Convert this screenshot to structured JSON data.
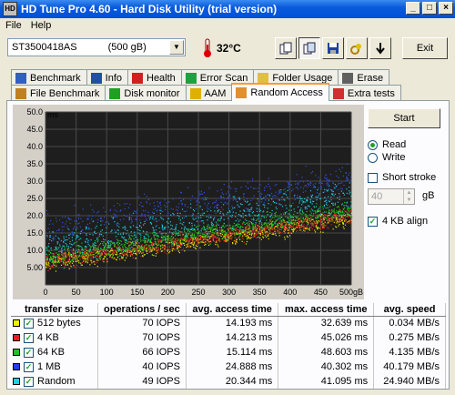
{
  "window": {
    "title": "HD Tune Pro 4.60 - Hard Disk Utility (trial version)",
    "icon_text": "HD"
  },
  "window_buttons": {
    "minimize": "_",
    "maximize": "□",
    "close": "×"
  },
  "menu": {
    "file": "File",
    "help": "Help"
  },
  "toolbar": {
    "drive": "ST3500418AS",
    "drive_size": "(500 gB)",
    "temperature": "32°C",
    "exit_label": "Exit",
    "buttons": [
      "copy-info-icon",
      "copy-screenshot-icon",
      "save-icon",
      "options-icon",
      "download-icon"
    ]
  },
  "tabs_top": [
    {
      "label": "Benchmark",
      "icon": "benchmark-icon",
      "color": "#3060c0"
    },
    {
      "label": "Info",
      "icon": "info-icon",
      "color": "#2050a0"
    },
    {
      "label": "Health",
      "icon": "health-icon",
      "color": "#d02020"
    },
    {
      "label": "Error Scan",
      "icon": "error-scan-icon",
      "color": "#20a040"
    },
    {
      "label": "Folder Usage",
      "icon": "folder-icon",
      "color": "#e0c040"
    },
    {
      "label": "Erase",
      "icon": "erase-icon",
      "color": "#606060"
    }
  ],
  "tabs_bottom": [
    {
      "label": "File Benchmark",
      "icon": "file-benchmark-icon",
      "color": "#c08020"
    },
    {
      "label": "Disk monitor",
      "icon": "disk-monitor-icon",
      "color": "#20a020"
    },
    {
      "label": "AAM",
      "icon": "speaker-icon",
      "color": "#e0b000"
    },
    {
      "label": "Random Access",
      "icon": "random-access-icon",
      "color": "#e09030",
      "active": true
    },
    {
      "label": "Extra tests",
      "icon": "extra-tests-icon",
      "color": "#d03030"
    }
  ],
  "controls": {
    "start_label": "Start",
    "read_label": "Read",
    "write_label": "Write",
    "mode": "read",
    "short_stroke_label": "Short stroke",
    "short_stroke_checked": false,
    "stroke_value": "40",
    "stroke_unit": "gB",
    "align_label": "4 KB align",
    "align_checked": true
  },
  "chart_data": {
    "type": "scatter",
    "ylabel": "ms",
    "xlabel": "gB",
    "xlim": [
      0,
      500
    ],
    "ylim": [
      0,
      50
    ],
    "y_ticks": [
      "50.0",
      "45.0",
      "40.0",
      "35.0",
      "30.0",
      "25.0",
      "20.0",
      "15.0",
      "10.0",
      "5.00"
    ],
    "x_ticks": [
      "0",
      "50",
      "100",
      "150",
      "200",
      "250",
      "300",
      "350",
      "400",
      "450",
      "500gB"
    ],
    "series": [
      {
        "name": "512 bytes",
        "color": "#e8e800",
        "min": 4.0,
        "max": 32.6
      },
      {
        "name": "4 KB",
        "color": "#e02020",
        "min": 4.0,
        "max": 45.0
      },
      {
        "name": "64 KB",
        "color": "#20c020",
        "min": 4.5,
        "max": 48.6
      },
      {
        "name": "1 MB",
        "color": "#3050e0",
        "min": 9.0,
        "max": 40.3
      },
      {
        "name": "Random",
        "color": "#20c8e0",
        "min": 5.0,
        "max": 41.1
      }
    ]
  },
  "results": {
    "headers": [
      "transfer size",
      "operations / sec",
      "avg. access time",
      "max. access time",
      "avg. speed"
    ],
    "rows": [
      {
        "name": "512 bytes",
        "color": "#f0f000",
        "ops": "70 IOPS",
        "avg": "14.193 ms",
        "max": "32.639 ms",
        "speed": "0.034 MB/s"
      },
      {
        "name": "4 KB",
        "color": "#e02020",
        "ops": "70 IOPS",
        "avg": "14.213 ms",
        "max": "45.026 ms",
        "speed": "0.275 MB/s"
      },
      {
        "name": "64 KB",
        "color": "#20c020",
        "ops": "66 IOPS",
        "avg": "15.114 ms",
        "max": "48.603 ms",
        "speed": "4.135 MB/s"
      },
      {
        "name": "1 MB",
        "color": "#2040e0",
        "ops": "40 IOPS",
        "avg": "24.888 ms",
        "max": "40.302 ms",
        "speed": "40.179 MB/s"
      },
      {
        "name": "Random",
        "color": "#20d0e0",
        "ops": "49 IOPS",
        "avg": "20.344 ms",
        "max": "41.095 ms",
        "speed": "24.940 MB/s"
      }
    ]
  }
}
